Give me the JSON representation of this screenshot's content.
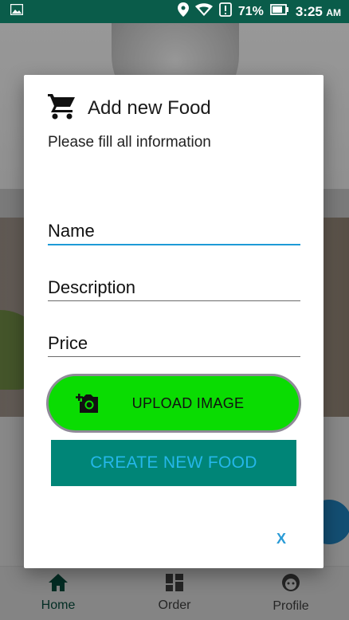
{
  "status_bar": {
    "battery_percent": "71%",
    "time": "3:25",
    "ampm": "AM"
  },
  "bottom_nav": {
    "items": [
      {
        "label": "Home",
        "icon": "home-icon",
        "active": true
      },
      {
        "label": "Order",
        "icon": "dashboard-icon",
        "active": false
      },
      {
        "label": "Profile",
        "icon": "face-icon",
        "active": false
      }
    ]
  },
  "dialog": {
    "title": "Add new Food",
    "subtitle": "Please fill all information",
    "fields": {
      "name": {
        "placeholder": "Name",
        "value": ""
      },
      "description": {
        "placeholder": "Description",
        "value": ""
      },
      "price": {
        "placeholder": "Price",
        "value": ""
      }
    },
    "upload_label": "UPLOAD IMAGE",
    "create_label": "CREATE NEW FOOD",
    "close_label": "X"
  },
  "colors": {
    "status_bar": "#0a5c4a",
    "upload_button": "#0adc02",
    "create_button": "#008577",
    "create_text": "#25b7ea",
    "focus_underline": "#1e9ad6"
  }
}
